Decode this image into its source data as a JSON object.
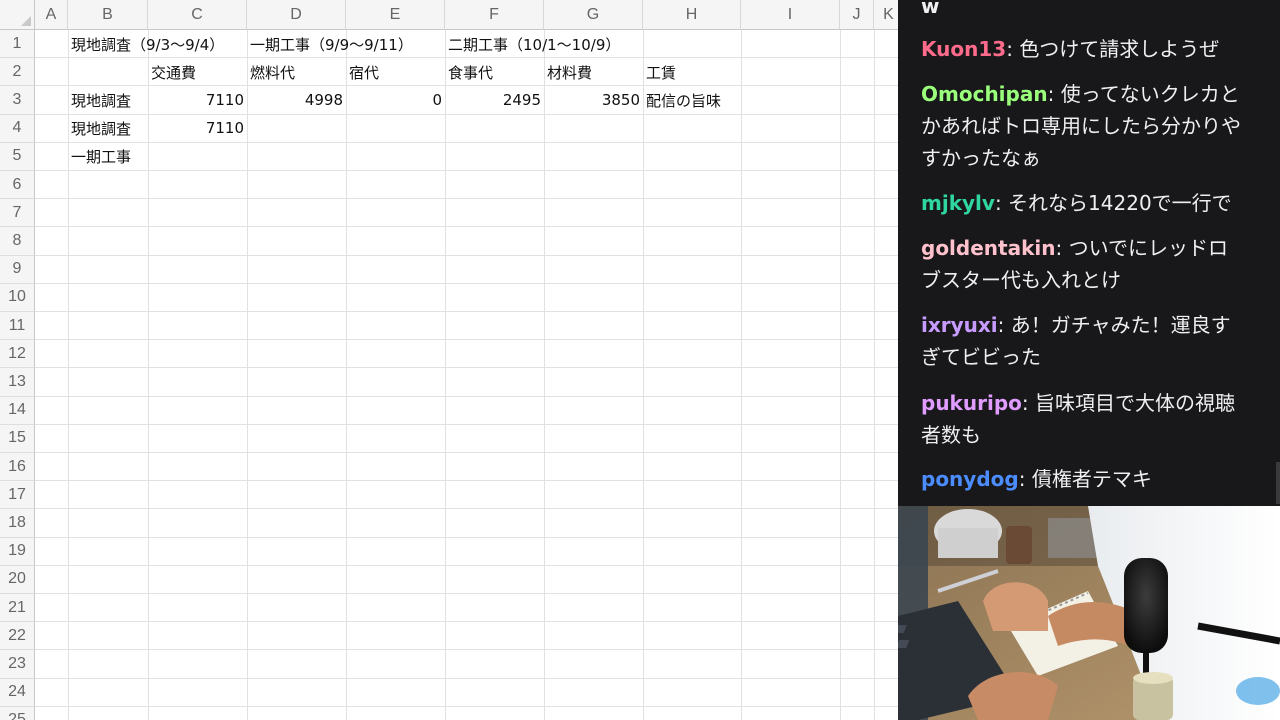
{
  "sheet": {
    "columns": [
      "A",
      "B",
      "C",
      "D",
      "E",
      "F",
      "G",
      "H",
      "I",
      "J",
      "K"
    ],
    "rows": [
      "1",
      "2",
      "3",
      "4",
      "5",
      "6",
      "7",
      "8",
      "9",
      "10",
      "11",
      "12",
      "13",
      "14",
      "15",
      "16",
      "17",
      "18",
      "19",
      "20",
      "21",
      "22",
      "23",
      "24",
      "25"
    ],
    "row1": {
      "b": "現地調査（9/3〜9/4）",
      "d": "一期工事（9/9〜9/11）",
      "f": "二期工事（10/1〜10/9）"
    },
    "row2": {
      "c": "交通費",
      "d": "燃料代",
      "e": "宿代",
      "f": "食事代",
      "g": "材料費",
      "h": "工賃"
    },
    "row3": {
      "b": "現地調査",
      "c": "7110",
      "d": "4998",
      "e": "0",
      "f": "2495",
      "g": "3850",
      "h": "配信の旨味"
    },
    "row4": {
      "b": "現地調査",
      "c": "7110"
    },
    "row5": {
      "b": "一期工事"
    }
  },
  "chat": {
    "messages": [
      {
        "user": "",
        "text": "w",
        "color": "#efeff1"
      },
      {
        "user": "Kuon13",
        "text": "色つけて請求しようぜ",
        "color": "#ff6b8b"
      },
      {
        "user": "Omochipan",
        "text": "使ってないクレカとかあればトロ専用にしたら分かりやすかったなぁ",
        "color": "#9aff7a"
      },
      {
        "user": "mjkylv",
        "text": "それなら14220で一行で",
        "color": "#2fd6a0"
      },
      {
        "user": "goldentakin",
        "text": "ついでにレッドロブスター代も入れとけ",
        "color": "#ffc2cc"
      },
      {
        "user": "ixryuxi",
        "text": "あ！ガチャみた！運良すぎてビビった",
        "color": "#c79bff"
      },
      {
        "user": "pukuripo",
        "text": "旨味項目で大体の視聴者数も",
        "color": "#e09cff"
      },
      {
        "user": "ponydog",
        "text": "債権者テマキ",
        "color": "#4b8cff"
      }
    ]
  },
  "camera": {
    "scene": "webcam-feed"
  }
}
